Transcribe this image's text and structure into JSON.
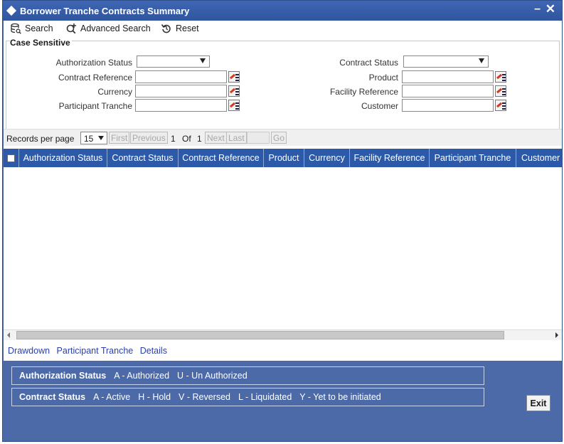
{
  "window": {
    "title": "Borrower Tranche Contracts Summary",
    "minimize_label": "–",
    "close_label": "✕"
  },
  "toolbar": {
    "search_label": "Search",
    "advanced_search_label": "Advanced Search",
    "reset_label": "Reset"
  },
  "criteria": {
    "legend": "Case Sensitive",
    "authorization_status_label": "Authorization Status",
    "contract_reference_label": "Contract Reference",
    "currency_label": "Currency",
    "participant_tranche_label": "Participant Tranche",
    "contract_status_label": "Contract Status",
    "product_label": "Product",
    "facility_reference_label": "Facility Reference",
    "customer_label": "Customer"
  },
  "pager": {
    "records_per_page_label": "Records per page",
    "records_per_page_value": "15",
    "first_label": "First",
    "previous_label": "Previous",
    "current_page": "1",
    "of_label": "Of",
    "total_pages": "1",
    "next_label": "Next",
    "last_label": "Last",
    "go_label": "Go"
  },
  "grid": {
    "columns": [
      "Authorization Status",
      "Contract Status",
      "Contract Reference",
      "Product",
      "Currency",
      "Facility Reference",
      "Participant Tranche",
      "Customer"
    ]
  },
  "links": {
    "drawdown": "Drawdown",
    "participant_tranche": "Participant Tranche",
    "details": "Details"
  },
  "legend_auth": {
    "key": "Authorization Status",
    "a": "A - Authorized",
    "u": "U - Un Authorized"
  },
  "legend_contract": {
    "key": "Contract Status",
    "a": "A - Active",
    "h": "H - Hold",
    "v": "V - Reversed",
    "l": "L - Liquidated",
    "y": "Y - Yet to be initiated"
  },
  "exit_label": "Exit",
  "colors": {
    "window_bg": "#4c6aa8",
    "header_bg": "#2d5aa8",
    "link": "#2a3fa8"
  },
  "icons": [
    "database-search-icon",
    "advanced-search-icon",
    "reset-icon",
    "lov-icon",
    "diamond-icon"
  ]
}
